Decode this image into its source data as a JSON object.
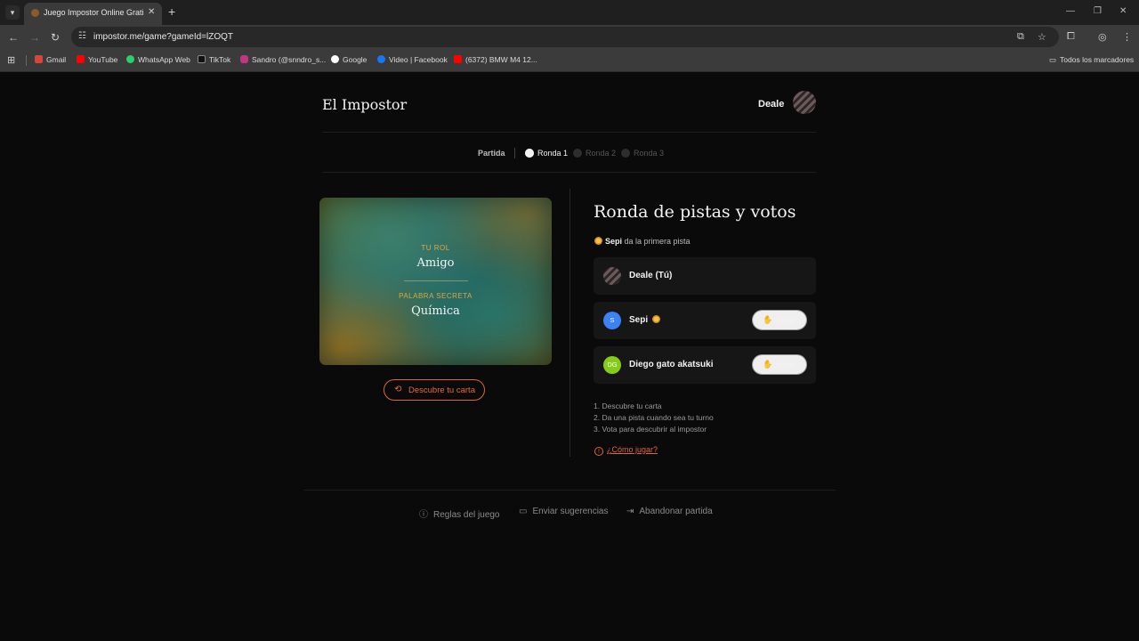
{
  "browser": {
    "tab_title": "Juego Impostor Online Gratis -",
    "url": "impostor.me/game?gameId=lZOQT",
    "bookmarks": [
      {
        "label": "Gmail",
        "color": "#d44638"
      },
      {
        "label": "YouTube",
        "color": "#ff0000"
      },
      {
        "label": "WhatsApp Web",
        "color": "#25d366"
      },
      {
        "label": "TikTok",
        "color": "#111111"
      },
      {
        "label": "Sandro (@snndro_s...",
        "color": "#c13584"
      },
      {
        "label": "Google",
        "color": "#ffffff"
      },
      {
        "label": "Video | Facebook",
        "color": "#1877f2"
      },
      {
        "label": "(6372) BMW M4 12...",
        "color": "#ff0000"
      }
    ],
    "all_bookmarks": "Todos los marcadores"
  },
  "header": {
    "brand": "El Impostor",
    "username": "Deale"
  },
  "progress": {
    "label": "Partida",
    "rounds": [
      {
        "label": "Ronda 1",
        "active": true
      },
      {
        "label": "Ronda 2",
        "active": false
      },
      {
        "label": "Ronda 3",
        "active": false
      }
    ]
  },
  "card": {
    "role_label": "TU ROL",
    "role_value": "Amigo",
    "word_label": "PALABRA SECRETA",
    "word_value": "Química",
    "reveal_button": "Descubre tu carta"
  },
  "round": {
    "title": "Ronda de pistas y votos",
    "hint_name": "Sepi",
    "hint_text": " da la primera pista"
  },
  "players": [
    {
      "name": "Deale (Tú)",
      "initials": "",
      "avatar_color": "#5a4848",
      "sun": false,
      "vote": ""
    },
    {
      "name": "Sepi",
      "initials": "S",
      "avatar_color": "#3b82f6",
      "sun": true,
      "vote": "Votar"
    },
    {
      "name": "Diego gato akatsuki",
      "initials": "DG",
      "avatar_color": "#84cc16",
      "sun": false,
      "vote": "Votar"
    }
  ],
  "instructions": [
    "1. Descubre tu carta",
    "2. Da una pista cuando sea tu turno",
    "3. Vota para descubrir al impostor"
  ],
  "how_to_play": "¿Cómo jugar?",
  "footer": {
    "rules": "Reglas del juego",
    "suggestions": "Enviar sugerencias",
    "leave": "Abandonar partida"
  },
  "colors": {
    "accent": "#e0663a",
    "card_label": "#e3a63a",
    "background": "#0a0a0a"
  }
}
